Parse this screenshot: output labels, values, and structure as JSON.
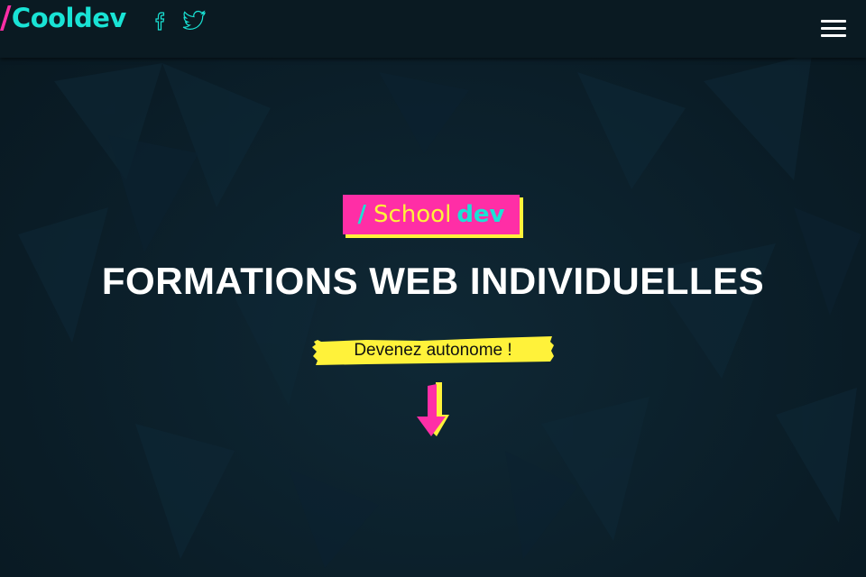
{
  "header": {
    "logo_slash": "/",
    "logo_text": "Cooldev",
    "social": [
      {
        "name": "facebook-icon"
      },
      {
        "name": "twitter-icon"
      }
    ],
    "menu_icon": "hamburger-icon"
  },
  "hero": {
    "badge": {
      "slash": "/",
      "school": "School",
      "dev": "dev"
    },
    "headline": "FORMATIONS WEB INDIVIDUELLES",
    "tagline": "Devenez autonome !",
    "scroll_icon": "arrow-down-icon"
  },
  "colors": {
    "background": "#0b1e29",
    "accent_pink": "#ff2ea6",
    "accent_cyan": "#19e3d5",
    "accent_yellow": "#fff23a"
  }
}
